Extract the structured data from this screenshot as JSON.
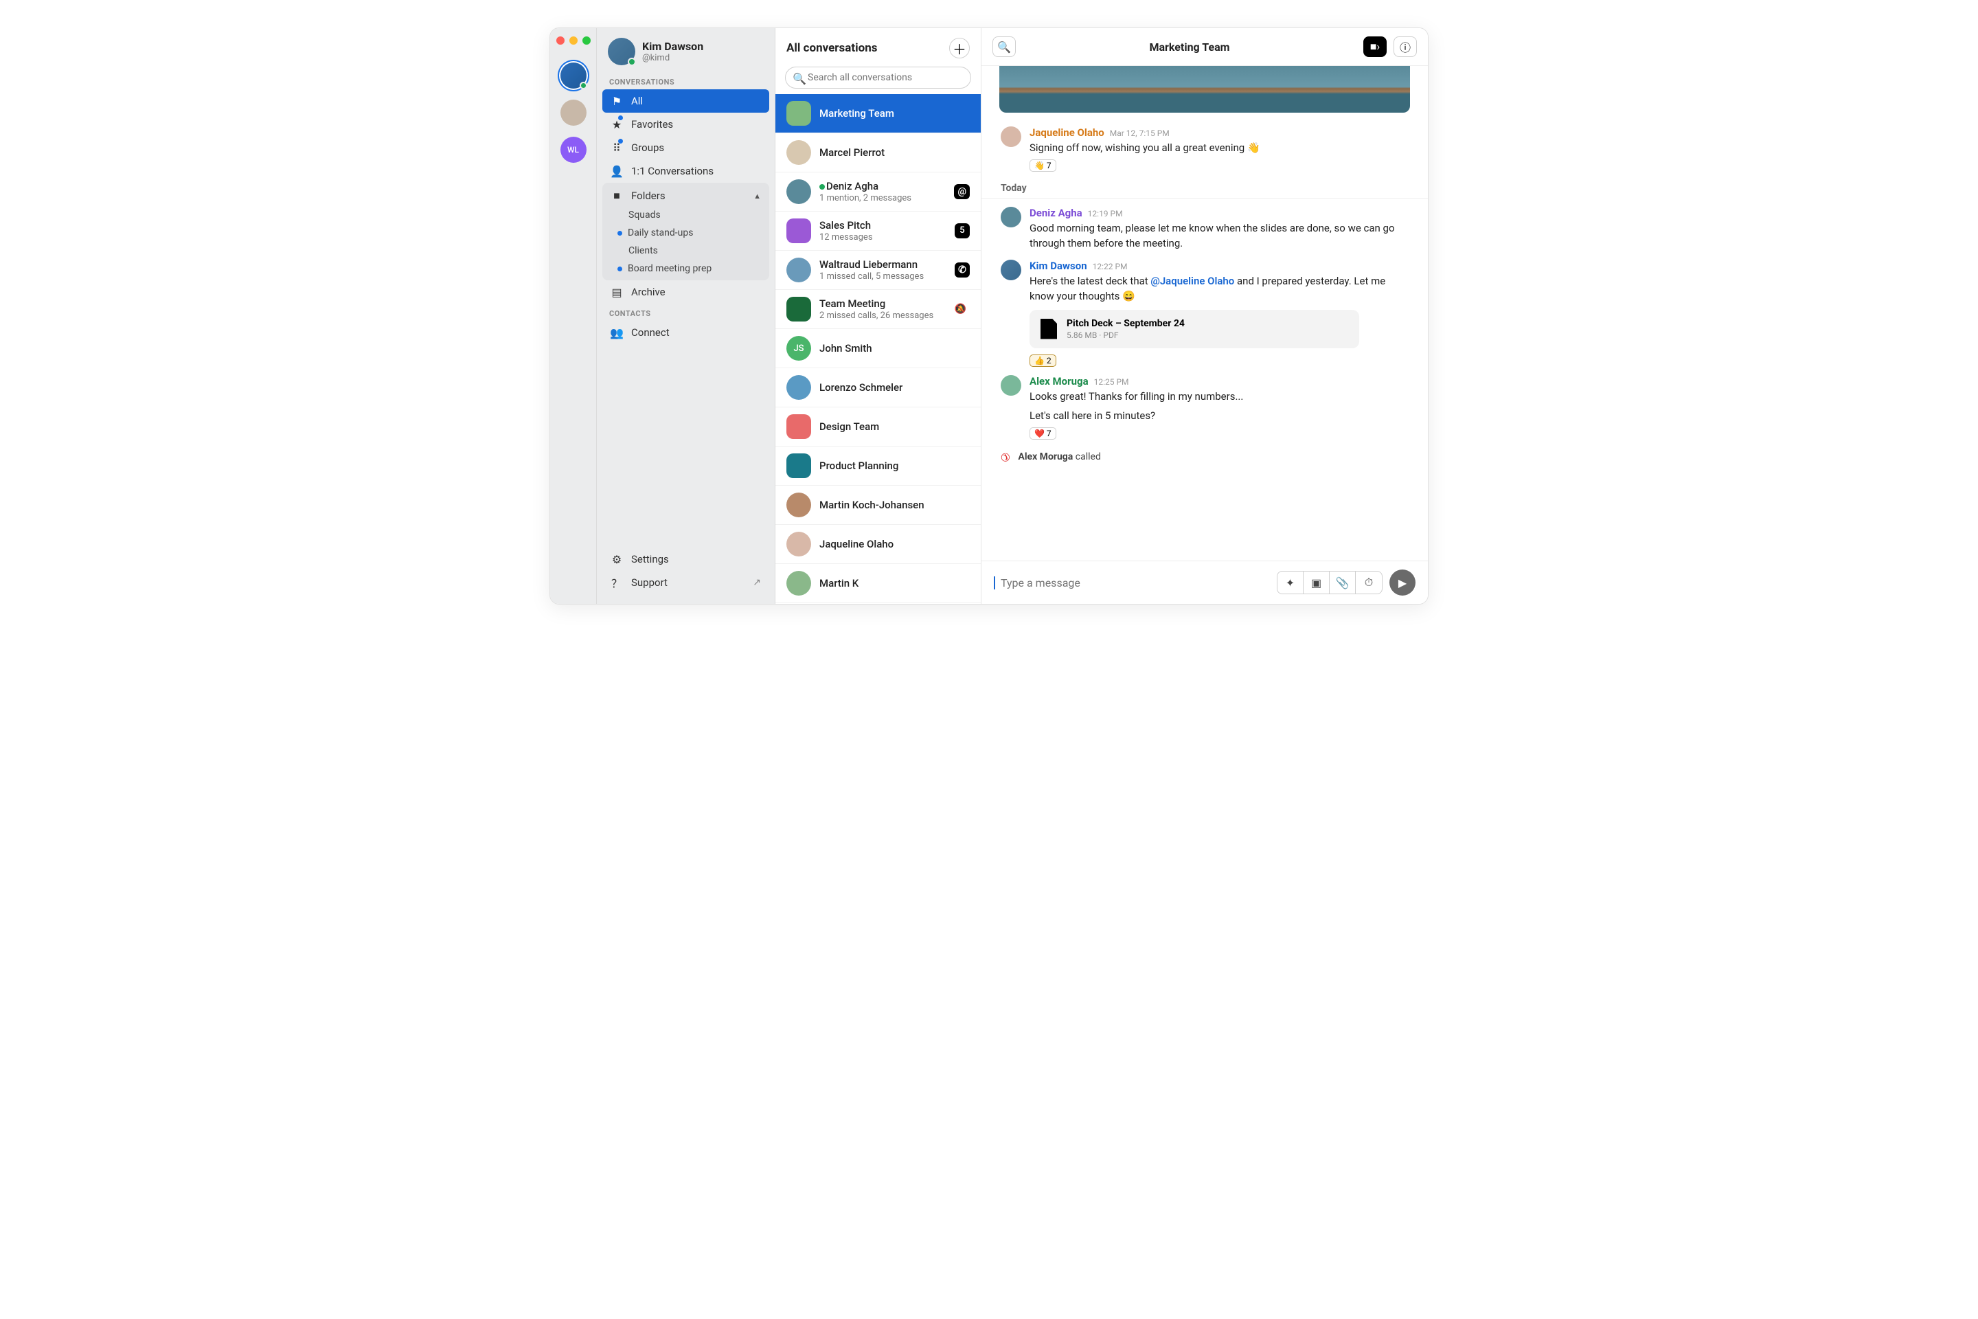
{
  "profile": {
    "name": "Kim Dawson",
    "handle": "@kimd"
  },
  "rail": {
    "wl": "WL"
  },
  "sidebar": {
    "sections": {
      "conversations": "CONVERSATIONS",
      "contacts": "CONTACTS"
    },
    "nav": {
      "all": "All",
      "favorites": "Favorites",
      "groups": "Groups",
      "oneone": "1:1 Conversations",
      "folders": "Folders",
      "archive": "Archive",
      "connect": "Connect",
      "settings": "Settings",
      "support": "Support"
    },
    "folders": {
      "squads": "Squads",
      "daily": "Daily stand-ups",
      "clients": "Clients",
      "board": "Board meeting prep"
    }
  },
  "convlist": {
    "title": "All conversations",
    "search_placeholder": "Search all conversations",
    "items": [
      {
        "name": "Marketing Team",
        "color": "#7fb97f"
      },
      {
        "name": "Marcel Pierrot",
        "avatar": "round",
        "color": "#d8c8b0"
      },
      {
        "name": "Deniz Agha",
        "sub": "1 mention, 2 messages",
        "avatar": "round",
        "color": "#5a8a9a",
        "badge": "@",
        "presence": true
      },
      {
        "name": "Sales Pitch",
        "sub": "12 messages",
        "color": "#9b59d6",
        "badge": "5"
      },
      {
        "name": "Waltraud Liebermann",
        "sub": "1 missed call, 5 messages",
        "avatar": "round",
        "color": "#6a9aba",
        "badge": "phone"
      },
      {
        "name": "Team Meeting",
        "sub": "2 missed calls, 26 messages",
        "color": "#1a6a3a",
        "badge": "mute"
      },
      {
        "name": "John Smith",
        "avatar": "round",
        "color": "#4ab56a",
        "initials": "JS"
      },
      {
        "name": "Lorenzo Schmeler",
        "avatar": "round",
        "color": "#5a9ac4"
      },
      {
        "name": "Design Team",
        "color": "#e86a6a"
      },
      {
        "name": "Product Planning",
        "color": "#1a7a8a"
      },
      {
        "name": "Martin Koch-Johansen",
        "avatar": "round",
        "color": "#b88a6a"
      },
      {
        "name": "Jaqueline Olaho",
        "avatar": "round",
        "color": "#d8b8a8"
      },
      {
        "name": "Martin K",
        "avatar": "round",
        "color": "#8ab88a"
      }
    ]
  },
  "chat": {
    "title": "Marketing Team",
    "divider": "Today",
    "composer_placeholder": "Type a message",
    "msgs": {
      "m1": {
        "author": "Jaqueline Olaho",
        "time": "Mar 12, 7:15 PM",
        "text": "Signing off now, wishing you all a great evening 👋",
        "reaction": "👋 7"
      },
      "m2": {
        "author": "Deniz Agha",
        "time": "12:19 PM",
        "text": "Good morning team, please let me know when the slides are done, so we can go through them before the meeting."
      },
      "m3": {
        "author": "Kim Dawson",
        "time": "12:22 PM",
        "text_pre": "Here's the latest deck that ",
        "mention": "@Jaqueline Olaho",
        "text_post": " and I prepared yesterday. Let me know your thoughts 😄",
        "attach_title": "Pitch Deck – September 24",
        "attach_meta": "5.86 MB · PDF",
        "reaction": "👍 2"
      },
      "m4": {
        "author": "Alex Moruga",
        "time": "12:25 PM",
        "text1": "Looks great! Thanks for filling in my numbers...",
        "text2": "Let's call here in 5 minutes?",
        "reaction": "❤️ 7"
      }
    },
    "call": {
      "who": "Alex Moruga",
      "verb": " called"
    }
  }
}
